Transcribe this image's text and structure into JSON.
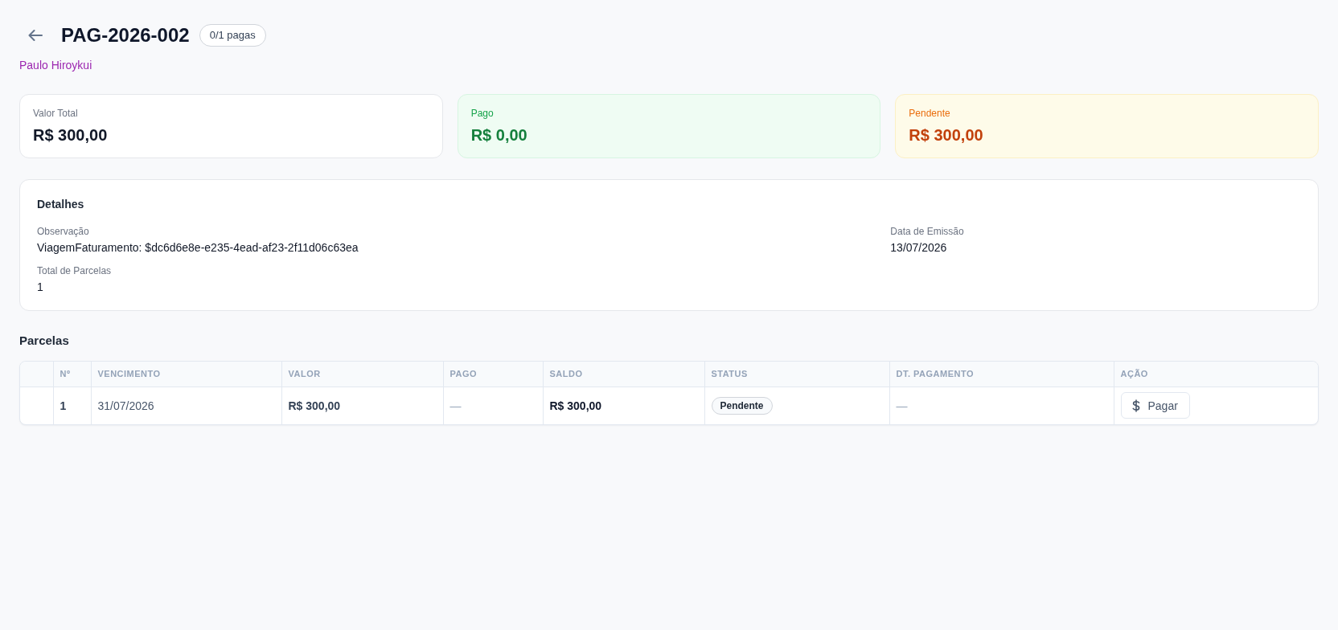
{
  "header": {
    "title": "PAG-2026-002",
    "badge": "0/1 pagas",
    "subtitle": "Paulo Hiroykui"
  },
  "summary_cards": [
    {
      "label": "Valor Total",
      "value": "R$ 300,00",
      "kind": "neutral"
    },
    {
      "label": "Pago",
      "value": "R$ 0,00",
      "kind": "success"
    },
    {
      "label": "Pendente",
      "value": "R$ 300,00",
      "kind": "warning"
    }
  ],
  "details": {
    "title": "Detalhes",
    "fields": [
      {
        "label": "Observação",
        "value": "ViagemFaturamento: $dc6d6e8e-e235-4ead-af23-2f11d06c63ea"
      },
      {
        "label": "Data de Emissão",
        "value": "13/07/2026"
      },
      {
        "label": "Total de Parcelas",
        "value": "1"
      }
    ]
  },
  "installments": {
    "title": "Parcelas",
    "columns": [
      "Nº",
      "VENCIMENTO",
      "VALOR",
      "PAGO",
      "SALDO",
      "STATUS",
      "DT. PAGAMENTO",
      "AÇÃO"
    ],
    "rows": [
      {
        "number": "1",
        "due_date": "31/07/2026",
        "amount": "R$ 300,00",
        "paid": "—",
        "balance": "R$ 300,00",
        "status": "Pendente",
        "payment_date": "—",
        "action": "Pagar"
      }
    ]
  }
}
